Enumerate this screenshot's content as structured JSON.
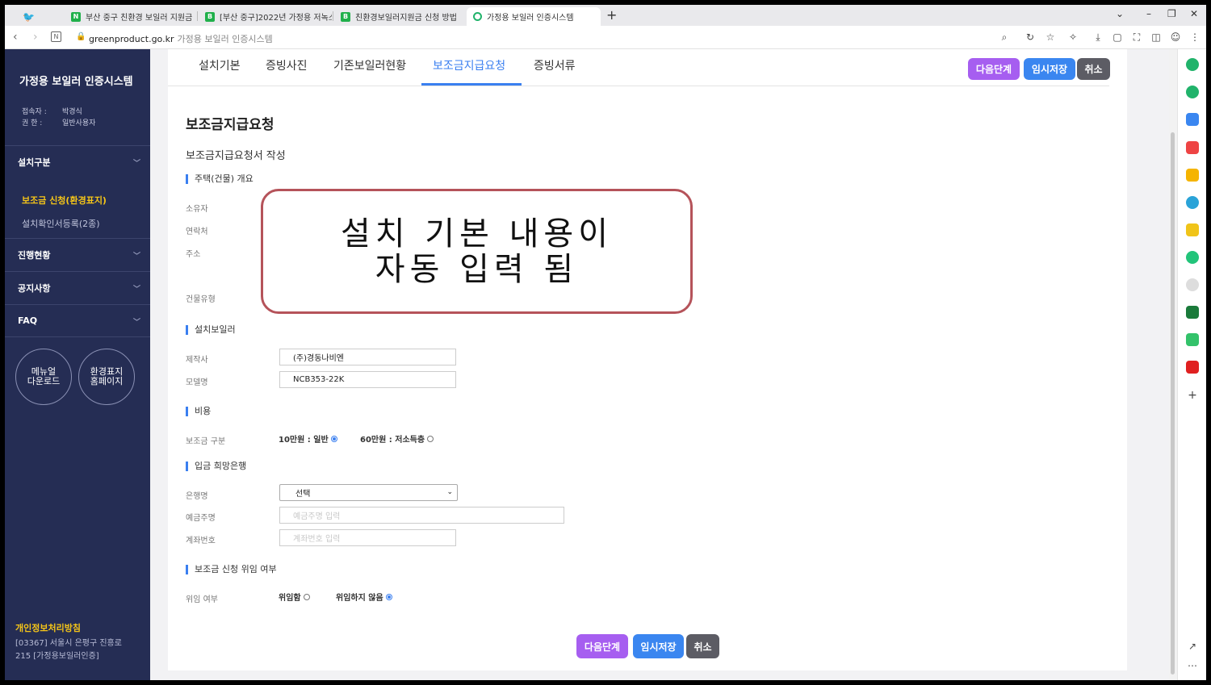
{
  "browser": {
    "tabs": [
      {
        "label": "부산 중구 친환경 보일러 지원금",
        "fav_color": "#20b04b",
        "fav_glyph": "N"
      },
      {
        "label": "[부산 중구]2022년 가정용 저녹스",
        "fav_color": "#20b04b",
        "fav_glyph": "B"
      },
      {
        "label": "친환경보일러지원금 신청 방법",
        "fav_color": "#20b04b",
        "fav_glyph": "B"
      },
      {
        "label": "가정용 보일러 인증시스템",
        "fav_color": "#21b36b",
        "fav_glyph": ""
      }
    ],
    "new_tab": "+",
    "url_host": "greenproduct.go.kr",
    "url_title": "가정용 보일러 인증시스템"
  },
  "sidebar": {
    "brand": "가정용 보일러 인증시스템",
    "user_label": "접속자 :",
    "user_value": "박경식",
    "role_label": "권    한 :",
    "role_value": "일반사용자",
    "sections": [
      {
        "label": "설치구분"
      },
      {
        "label": "진행현황"
      },
      {
        "label": "공지사항"
      },
      {
        "label": "FAQ"
      }
    ],
    "sub_items": [
      {
        "label": "보조금 신청(환경표지)",
        "active": true
      },
      {
        "label": "설치확인서등록(2종)",
        "active": false
      }
    ],
    "manual_btn": [
      "메뉴얼",
      "다운로드"
    ],
    "home_btn": [
      "환경표지",
      "홈페이지"
    ],
    "privacy": "개인정보처리방침",
    "address_line1": "[03367] 서울시 은평구 진흥로",
    "address_line2": "215 [가정용보일러인증]"
  },
  "page_tabs": [
    {
      "label": "설치기본",
      "active": false
    },
    {
      "label": "증빙사진",
      "active": false
    },
    {
      "label": "기존보일러현황",
      "active": false
    },
    {
      "label": "보조금지급요청",
      "active": true
    },
    {
      "label": "증빙서류",
      "active": false
    }
  ],
  "actions": {
    "next": "다음단계",
    "save": "임시저장",
    "cancel": "취소"
  },
  "form": {
    "page_title": "보조금지급요청",
    "form_title": "보조금지급요청서 작성",
    "sec_house": "주택(건물) 개요",
    "owner_label": "소유자",
    "contact_label": "연락처",
    "address_label": "주소",
    "building_type_label": "건물유형",
    "sec_boiler": "설치보일러",
    "maker_label": "제작사",
    "maker_value": "(주)경동나비엔",
    "model_label": "모델명",
    "model_value": "NCB353-22K",
    "sec_cost": "비용",
    "subsidy_label": "보조금 구분",
    "subsidy_opt1": "10만원 : 일반",
    "subsidy_opt2": "60만원 : 저소득층",
    "sec_bank": "입금 희망은행",
    "bank_label": "은행명",
    "bank_value": "선택",
    "holder_label": "예금주명",
    "holder_placeholder": "예금주명 입력",
    "account_label": "계좌번호",
    "account_placeholder": "계좌번호 입력",
    "sec_delegate": "보조금 신청 위임 여부",
    "delegate_label": "위임 여부",
    "delegate_yes": "위임함",
    "delegate_no": "위임하지 않음"
  },
  "subsidy_selected": "10만원 : 일반",
  "delegate_selected": "위임하지 않음",
  "callout": {
    "line1": "설치 기본 내용이",
    "line2": "자동 입력 됨"
  },
  "colors": {
    "sidebar_bg": "#252d54",
    "accent_blue": "#3a7ff0",
    "purple": "#a65ef0",
    "highlight_yellow": "#f5c518",
    "callout_border": "#b5535a"
  }
}
